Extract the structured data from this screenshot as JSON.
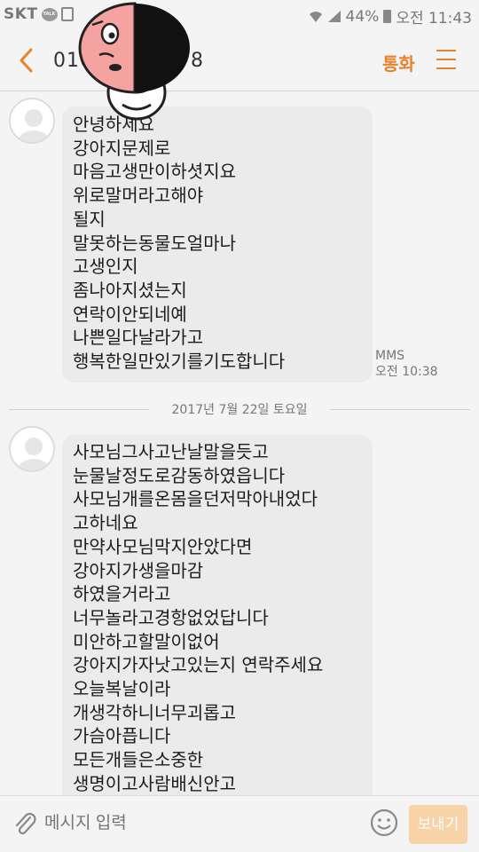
{
  "status_bar": {
    "carrier": "SKT",
    "talk_label": "TALK",
    "battery": "44%",
    "time": "오전 11:43"
  },
  "header": {
    "phone_number_start": "010",
    "phone_number_end": "8",
    "call_label": "통화"
  },
  "messages": [
    {
      "lines": [
        "안녕하세요",
        "강아지문제로",
        "마음고생만이하셧지요",
        "위로말머라고해야",
        "될지",
        "말못하는동물도얼마나",
        "고생인지",
        "좀나아지셨는지",
        "연락이안되네예",
        "나쁜일다날라가고",
        "행복한일만있기를기도합니다"
      ],
      "type": "MMS",
      "time": "오전 10:38"
    },
    {
      "lines": [
        "사모님그사고난날말을듯고",
        "눈물날정도로감동하였읍니다",
        "사모님개를온몸을던저막아내었다",
        "고하네요",
        "만약사모님막지안았다면",
        "강아지가생을마감",
        "하였을거라고",
        "너무놀라고경항없었답니다",
        "미안하고할말이없어",
        "강아지가자낫고있는지  연락주세요",
        "오늘복날이라",
        "개생각하니너무괴롭고",
        "가슴아픕니다",
        "모든개들은소중한",
        "생명이고사람배신안고"
      ]
    }
  ],
  "date_separator": "2017년 7월 22일 토요일",
  "composer": {
    "placeholder": "메시지 입력",
    "send_label": "보내기"
  },
  "colors": {
    "accent": "#e8832b",
    "bubble": "#ebebeb",
    "background": "#f4f4f4",
    "send_disabled": "#f8d3a7"
  },
  "icons": [
    "back-arrow-icon",
    "menu-icon",
    "wifi-icon",
    "signal-icon",
    "battery-icon",
    "attach-icon",
    "emoji-icon"
  ]
}
